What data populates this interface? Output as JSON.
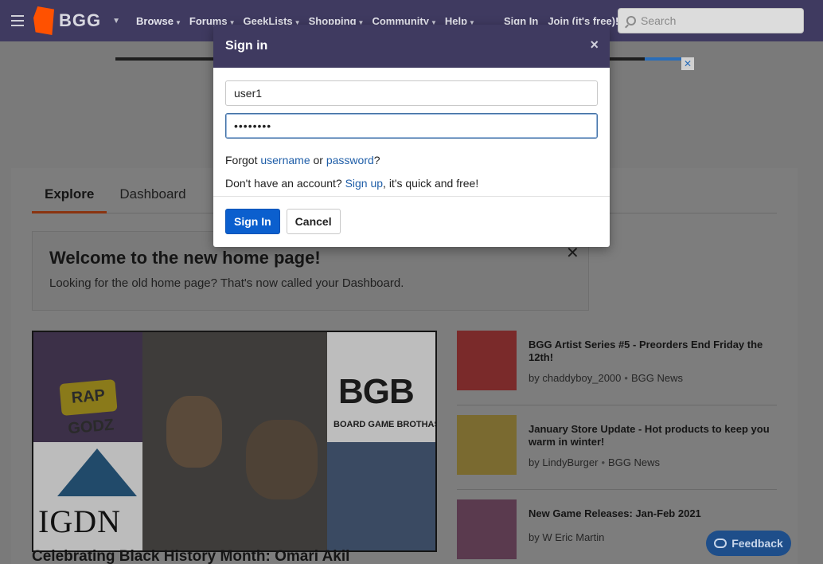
{
  "nav": {
    "logo_text": "BGG",
    "items": [
      {
        "label": "Browse"
      },
      {
        "label": "Forums"
      },
      {
        "label": "GeekLists"
      },
      {
        "label": "Shopping"
      },
      {
        "label": "Community"
      },
      {
        "label": "Help"
      }
    ],
    "sign_in": "Sign In",
    "join": "Join (it's free)!",
    "search_placeholder": "Search"
  },
  "tabs": [
    {
      "label": "Explore",
      "active": true
    },
    {
      "label": "Dashboard",
      "active": false
    }
  ],
  "welcome": {
    "title": "Welcome to the new home page!",
    "text": "Looking for the old home page? That's now called your Dashboard."
  },
  "feature": {
    "title": "Celebrating Black History Month: Omari Akil",
    "art_text": {
      "rap": "RAP GODZ",
      "bgb": "BGB",
      "bgb_sub": "BOARD GAME BROTHAS",
      "igdn": "IGDN"
    }
  },
  "news": [
    {
      "title": "BGG Artist Series #5 - Preorders End Friday the 12th!",
      "author": "chaddyboy_2000",
      "category": "BGG News"
    },
    {
      "title": "January Store Update - Hot products to keep you warm in winter!",
      "author": "LindyBurger",
      "category": "BGG News"
    },
    {
      "title": "New Game Releases: Jan-Feb 2021",
      "author": "W Eric Martin",
      "category": ""
    }
  ],
  "byline_prefix": "by",
  "feedback_label": "Feedback",
  "modal": {
    "title": "Sign in",
    "close": "×",
    "username_value": "user1",
    "password_value": "••••••••",
    "forgot_prefix": "Forgot ",
    "forgot_username": "username",
    "forgot_or": " or ",
    "forgot_password": "password",
    "forgot_suffix": "?",
    "signup_prefix": "Don't have an account? ",
    "signup_link": "Sign up",
    "signup_suffix": ", it's quick and free!",
    "submit_label": "Sign In",
    "cancel_label": "Cancel"
  },
  "icons": {
    "menu": "hamburger-icon",
    "search": "search-icon",
    "close": "close-icon",
    "feedback": "chat-bubble-icon"
  },
  "colors": {
    "brand_purple": "#3f3a60",
    "brand_orange": "#ff5100",
    "primary_button": "#0b5fce",
    "link": "#1f5ea8"
  }
}
